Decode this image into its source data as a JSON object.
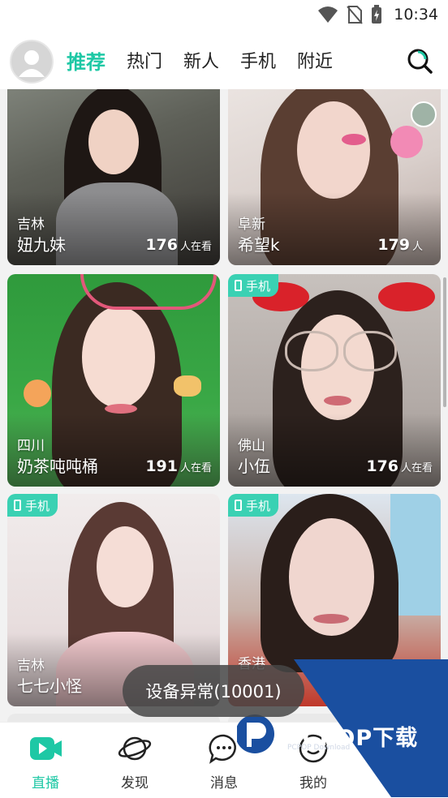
{
  "status_bar": {
    "time": "10:34"
  },
  "header": {
    "tabs": [
      {
        "label": "推荐",
        "active": true
      },
      {
        "label": "热门",
        "active": false
      },
      {
        "label": "新人",
        "active": false
      },
      {
        "label": "手机",
        "active": false
      },
      {
        "label": "附近",
        "active": false
      }
    ]
  },
  "streams": [
    {
      "location": "吉林",
      "name": "妞九妹",
      "viewers": "176",
      "viewer_unit": "人在看",
      "badge": ""
    },
    {
      "location": "阜新",
      "name": "希望k",
      "viewers": "179",
      "viewer_unit": "人",
      "badge": ""
    },
    {
      "location": "四川",
      "name": "奶茶吨吨桶",
      "viewers": "191",
      "viewer_unit": "人在看",
      "badge": ""
    },
    {
      "location": "佛山",
      "name": "小伍",
      "viewers": "176",
      "viewer_unit": "人在看",
      "badge": "手机"
    },
    {
      "location": "吉林",
      "name": "七七小怪",
      "viewers": "",
      "viewer_unit": "",
      "badge": "手机"
    },
    {
      "location": "香港",
      "name": "",
      "viewers": "",
      "viewer_unit": "",
      "badge": "手机"
    }
  ],
  "toast": {
    "message": "设备异常(10001)"
  },
  "bottom_nav": [
    {
      "label": "直播",
      "active": true
    },
    {
      "label": "发现",
      "active": false
    },
    {
      "label": "消息",
      "active": false
    },
    {
      "label": "我的",
      "active": false
    }
  ],
  "watermark": {
    "brand": "PCPOP下载",
    "sub": "PCPOP Download"
  },
  "colors": {
    "accent": "#1ec8a5",
    "badge": "#3ad1b3",
    "watermark": "#1a4fa0"
  }
}
